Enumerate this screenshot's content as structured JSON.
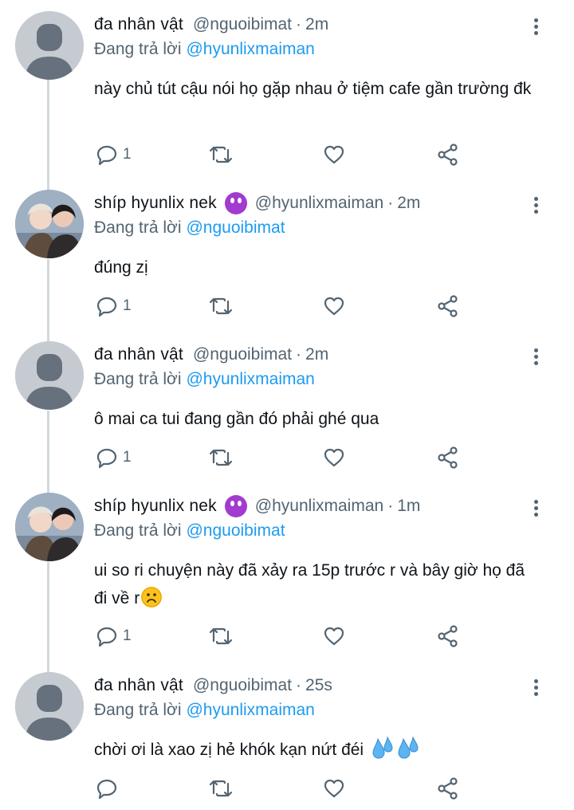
{
  "thread": [
    {
      "name": "đa nhân vật",
      "handle": "@nguoibimat",
      "time": "2m",
      "replying_label": "Đang trả lời",
      "replying_to": "@hyunlixmaiman",
      "text": "này chủ tút cậu nói họ gặp nhau ở tiệm cafe gần trường đk",
      "reply_count": "1",
      "avatar": "default-avatar"
    },
    {
      "name": "shíp hyunlix nek",
      "handle": "@hyunlixmaiman",
      "time": "2m",
      "replying_label": "Đang trả lời",
      "replying_to": "@nguoibimat",
      "text": "đúng zị",
      "reply_count": "1",
      "avatar": "photo-avatar"
    },
    {
      "name": "đa nhân vật",
      "handle": "@nguoibimat",
      "time": "2m",
      "replying_label": "Đang trả lời",
      "replying_to": "@hyunlixmaiman",
      "text": "ô mai ca tui đang gần đó phải ghé qua",
      "reply_count": "1",
      "avatar": "default-avatar"
    },
    {
      "name": "shíp hyunlix nek",
      "handle": "@hyunlixmaiman",
      "time": "1m",
      "replying_label": "Đang trả lời",
      "replying_to": "@nguoibimat",
      "text": "ui so ri chuyện này đã xảy ra 15p trước r và bây giờ họ đã đi về r",
      "reply_count": "1",
      "avatar": "photo-avatar"
    },
    {
      "name": "đa nhân vật",
      "handle": "@nguoibimat",
      "time": "25s",
      "replying_label": "Đang trả lời",
      "replying_to": "@hyunlixmaiman",
      "text": "chời ơi là xao zị hẻ khók kạn nứt đéi",
      "reply_count": "",
      "avatar": "default-avatar"
    }
  ],
  "icons": {
    "reply": "reply-icon",
    "retweet": "retweet-icon",
    "like": "like-icon",
    "share": "share-icon",
    "more": "more-icon",
    "devil_emoji": "smiling-devil-emoji",
    "sad_emoji": "frowning-face-emoji",
    "sweat_emoji": "sweat-droplets-emoji"
  },
  "colors": {
    "mention": "#1d9bf0",
    "secondary_text": "#536471",
    "primary_text": "#0f1419",
    "thread_line": "#cfd9de"
  }
}
